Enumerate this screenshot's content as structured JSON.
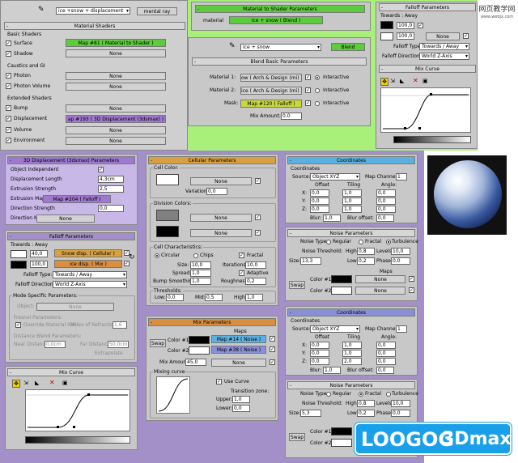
{
  "watermark": {
    "line1": "网页教学网",
    "line2": "www.webjx.com"
  },
  "mat_shaders": {
    "top_select": "ice +snow + displacement",
    "top_type": "mental ray",
    "title": "Material Shaders",
    "basic": "Basic Shaders",
    "surface_label": "Surface",
    "surface_map": "Map #81  ( Material to Shader )",
    "shadow_label": "Shadow",
    "none": "None",
    "caustics": "Caustics and GI",
    "photon": "Photon",
    "photon_vol": "Photon Volume",
    "extended": "Extended Shaders",
    "bump": "Bump",
    "displacement": "Displacement",
    "displacement_map": "ap #193  ( 3D Displacement (3dsmax) )",
    "volume": "Volume",
    "environment": "Environment"
  },
  "mts": {
    "title": "Material to Shader Parameters",
    "material_label": "material",
    "material_value": "ice + snow  ( Blend )"
  },
  "blend": {
    "select": "ice + snow",
    "type": "Blend",
    "title": "Blend Basic Parameters",
    "m1_label": "Material 1:",
    "m1_value": "ow  ( Arch & Design (mi) )",
    "m2_label": "Material 2:",
    "m2_value": "ice  ( Arch & Design (mi) )",
    "mask_label": "Mask:",
    "mask_value": "Map #120  ( Falloff )",
    "interactive": "Interactive",
    "mix_label": "Mix Amount:",
    "mix_value": "0,0"
  },
  "falloff_tr": {
    "title": "Falloff Parameters",
    "towards": "Towards : Away",
    "v1": "100,0",
    "v2": "100,0",
    "none": "None",
    "type_label": "Falloff Type:",
    "type_value": "Towards / Away",
    "dir_label": "Falloff Direction:",
    "dir_value": "World Z-Axis",
    "mix_curve": "Mix Curve"
  },
  "disp": {
    "title": "3D Displacement (3dsmax) Parameters",
    "obj_indep": "Object Independent",
    "disp_len": "Displacement Length",
    "disp_len_v": "4,3cm",
    "ext_str": "Extrusion Strength",
    "ext_str_v": "2,5",
    "ext_map": "Extrusion Map",
    "ext_map_v": "Map #204  ( Falloff )",
    "dir_str": "Direction Strength",
    "dir_str_v": "0,0",
    "dir_map": "Direction Map",
    "dir_map_v": "None"
  },
  "falloff_bl": {
    "title": "Falloff Parameters",
    "towards": "Towards : Away",
    "v1": "40,0",
    "v2": "100,0",
    "m1": "Snow disp.  ( Cellular )",
    "m2": "ice disp.  ( Mix )",
    "type_label": "Falloff Type:",
    "type_value": "Towards / Away",
    "dir_label": "Falloff Direction:",
    "dir_value": "World Z-Axis",
    "mode": "Mode Specific Parameters:",
    "object": "Object:",
    "none": "None",
    "fresnel": "Fresnel Parameters:",
    "override": "Override Material IOR",
    "ior": "Index of Refraction",
    "ior_v": "1,6",
    "dist": "Distance Blend Parameters:",
    "near": "Near Distance:",
    "near_v": "0,0cm",
    "far": "Far Distance:",
    "far_v": "50,0cm",
    "extrapolate": "Extrapolate",
    "mix_curve": "Mix Curve"
  },
  "cellular": {
    "title": "Cellular Parameters",
    "cell_color": "Cell Color:",
    "none": "None",
    "variation": "Variation:",
    "variation_v": "0,0",
    "div_colors": "Division Colors:",
    "char": "Cell Characteristics:",
    "circular": "Circular",
    "chips": "Chips",
    "fractal": "Fractal",
    "size": "Size:",
    "size_v": "10,0",
    "iterations": "Iterations:",
    "iterations_v": "10,0",
    "spread": "Spread:",
    "spread_v": "1,0",
    "adaptive": "Adaptive",
    "bump_smooth": "Bump Smoothing:",
    "bump_smooth_v": "1,0",
    "roughness": "Roughness:",
    "roughness_v": "0,2",
    "thresholds": "Thresholds:",
    "low": "Low:",
    "low_v": "0,0",
    "mid": "Mid:",
    "mid_v": "0,5",
    "high": "High:",
    "high_v": "1,0"
  },
  "mix": {
    "title": "Mix Parameters",
    "maps": "Maps",
    "swap": "Swap",
    "c1": "Color #1",
    "c2": "Color #2",
    "m1": "Map #14  ( Noise )",
    "m2": "Map #38  ( Noise )",
    "amount": "Mix Amount:",
    "amount_v": "45,0",
    "curve": "Mixing curve",
    "use_curve": "Use Curve",
    "tz": "Transition zone:",
    "upper": "Upper:",
    "upper_v": "1,0",
    "lower": "Lower:",
    "lower_v": "0,0"
  },
  "coords1": {
    "title": "Coordinates",
    "coords": "Coordinates",
    "source": "Source:",
    "source_v": "Object XYZ",
    "channel": "Map Channel:",
    "channel_v": "1",
    "offset": "Offset",
    "tiling": "Tiling",
    "angle": "Angle:",
    "x": "X:",
    "y": "Y:",
    "z": "Z:",
    "zero": "0,0",
    "one": "1,0",
    "blur": "Blur:",
    "blur_v": "1,0",
    "blur_off": "Blur offset:",
    "blur_off_v": "0,0"
  },
  "noise1": {
    "title": "Noise Parameters",
    "type": "Noise Type:",
    "regular": "Regular",
    "fractal": "Fractal",
    "turbulence": "Turbulence",
    "thresh": "Noise Threshold:",
    "high": "High:",
    "high_v": "0,8",
    "levels": "Levels:",
    "levels_v": "10,0",
    "size": "Size:",
    "size_v": "13,3",
    "low": "Low:",
    "low_v": "0,2",
    "phase": "Phase:",
    "phase_v": "0,0",
    "maps": "Maps",
    "swap": "Swap",
    "c1": "Color #1",
    "c2": "Color #2",
    "none": "None"
  },
  "coords2": {
    "title": "Coordinates",
    "coords": "Coordinates",
    "source": "Source:",
    "source_v": "Object XYZ",
    "channel": "Map Channel:",
    "channel_v": "1",
    "offset": "Offset",
    "tiling": "Tiling",
    "angle": "Angle:",
    "x": "X:",
    "y": "Y:",
    "z": "Z:",
    "zero": "0,0",
    "one": "1,0",
    "t2": "2,0",
    "blur": "Blur:",
    "blur_v": "1,0",
    "blur_off": "Blur offset:",
    "blur_off_v": "0,0"
  },
  "noise2": {
    "title": "Noise Parameters",
    "type": "Noise Type:",
    "regular": "Regular",
    "fractal": "Fractal",
    "turbulence": "Turbulence",
    "thresh": "Noise Threshold:",
    "high": "High:",
    "high_v": "0,8",
    "levels": "Levels:",
    "levels_v": "10,0",
    "size": "Size:",
    "size_v": "5,3",
    "low": "Low:",
    "low_v": "0,2",
    "phase": "Phase:",
    "phase_v": "0,0",
    "swap": "Swap",
    "c1": "Color #1",
    "c2": "Color #2"
  },
  "logo": {
    "a": "LOOGOG",
    "b": "3Dmax"
  },
  "colors": {
    "green": "#a8f07a",
    "purple": "#a490c8",
    "lavender": "#c8b8e8",
    "blue_bg": "#b8c4e0",
    "surface_btn": "#5ccc3c",
    "disp_btn": "#a078d0",
    "mask_btn": "#c8d83c",
    "snow_btn": "#d8a040",
    "ice_btn": "#d89040",
    "noise1_btn": "#5cb0e0",
    "noise2_btn": "#8890d8"
  }
}
